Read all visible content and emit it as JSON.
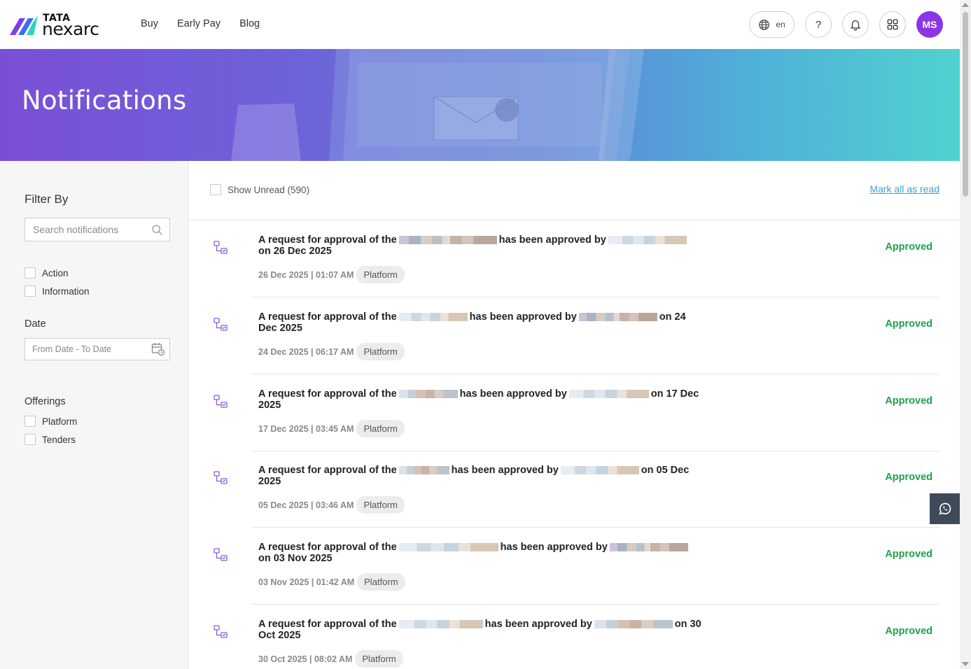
{
  "header": {
    "logo_top": "TATA",
    "logo_bottom": "nexarc",
    "nav": [
      "Buy",
      "Early Pay",
      "Blog"
    ],
    "lang": "en",
    "help": "?",
    "avatar": "MS"
  },
  "banner": {
    "title": "Notifications"
  },
  "sidebar": {
    "filter_title": "Filter By",
    "search_placeholder": "Search notifications",
    "types": [
      "Action",
      "Information"
    ],
    "date_label": "Date",
    "date_placeholder": "From Date - To Date",
    "offerings_label": "Offerings",
    "offerings": [
      "Platform",
      "Tenders"
    ]
  },
  "toolbar": {
    "show_unread": "Show Unread (590)",
    "mark_all": "Mark all as read"
  },
  "notifications": [
    {
      "p1": "A request for approval of the",
      "p2": "has been approved by",
      "p3": "on 26 Dec 2025",
      "meta": "26 Dec 2025 | 01:07 AM",
      "tag": "Platform",
      "status": "Approved"
    },
    {
      "p1": "A request for approval of the",
      "p2": "has been approved by",
      "p3": "on 24 Dec 2025",
      "meta": "24 Dec 2025 | 06:17 AM",
      "tag": "Platform",
      "status": "Approved"
    },
    {
      "p1": "A request for approval of the",
      "p2": "has been approved by",
      "p3": "on 17 Dec 2025",
      "meta": "17 Dec 2025 | 03:45 AM",
      "tag": "Platform",
      "status": "Approved"
    },
    {
      "p1": "A request for approval of the",
      "p2": "has been approved by",
      "p3": "on 05 Dec 2025",
      "meta": "05 Dec 2025 | 03:46 AM",
      "tag": "Platform",
      "status": "Approved"
    },
    {
      "p1": "A request for approval of the",
      "p2": "has been approved by",
      "p3": "on 03 Nov 2025",
      "meta": "03 Nov 2025 | 01:42 AM",
      "tag": "Platform",
      "status": "Approved"
    },
    {
      "p1": "A request for approval of the",
      "p2": "has been approved by",
      "p3": "on 30 Oct 2025",
      "meta": "30 Oct 2025 | 08:02 AM",
      "tag": "Platform",
      "status": "Approved"
    }
  ],
  "colors": {
    "accent": "#8b35e6",
    "status_green": "#1ea04b",
    "link_blue": "#3a9fd6"
  }
}
